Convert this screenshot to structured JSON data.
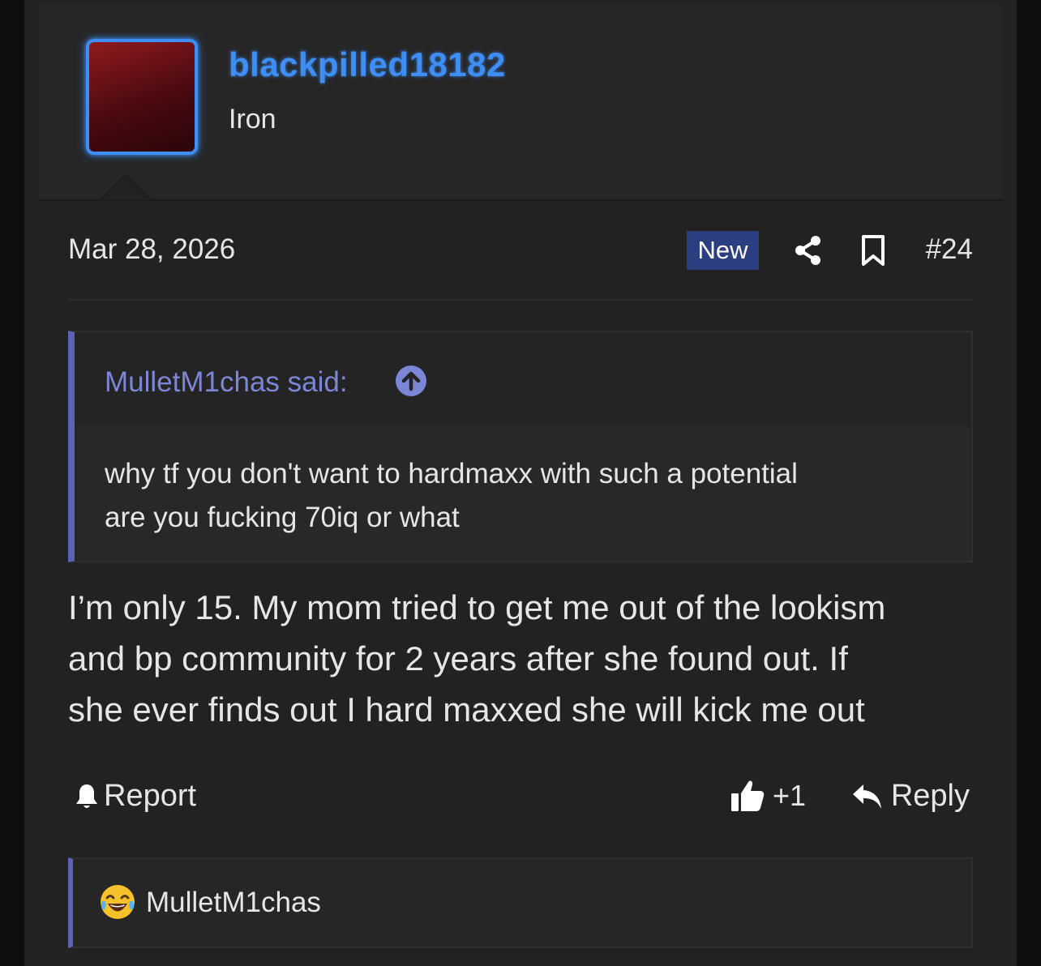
{
  "user": {
    "username": "blackpilled18182",
    "title": "Iron",
    "avatar_colors": [
      "#8f1a1e",
      "#2a0509"
    ],
    "accent": "#3d8ef5"
  },
  "post": {
    "date": "Mar 28, 2026",
    "new_badge": "New",
    "number": "#24",
    "icons": [
      "share-icon",
      "bookmark-icon"
    ]
  },
  "quote": {
    "author_label": "MulletM1chas said:",
    "icon": "arrow-up-circle-icon",
    "lines": [
      "why tf you don't want to hardmaxx with such a potential",
      "are you fucking 70iq or what"
    ]
  },
  "message": {
    "lines": [
      "I’m only 15. My mom tried to get me out of the lookism",
      "and bp community for 2 years after she found out. If",
      "she ever finds out I hard maxxed she will kick me out"
    ]
  },
  "actions": {
    "report_label": "Report",
    "like_count": "+1",
    "reply_label": "Reply"
  },
  "reactions": {
    "emoji": "laughing-tears-emoji",
    "user": "MulletM1chas"
  },
  "colors": {
    "quote_border": "#5a63b6",
    "quote_author": "#7c86d6",
    "badge_bg": "#2b3f80"
  }
}
